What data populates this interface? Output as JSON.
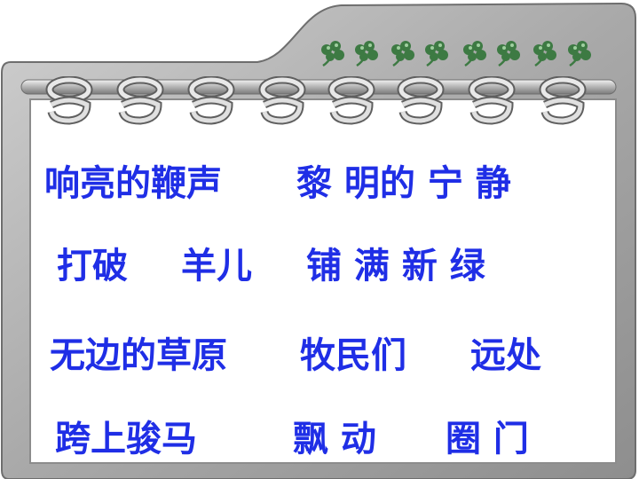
{
  "lines": [
    [
      "响亮的鞭声",
      "黎 明的 宁 静"
    ],
    [
      "打破",
      "羊儿",
      "铺 满 新 绿"
    ],
    [
      "无边的草原",
      "牧民们",
      "远处"
    ],
    [
      "跨上骏马",
      "飘 动",
      "圈  门"
    ]
  ],
  "colors": {
    "frame": "#a7a7a7",
    "text": "#1f2ee6",
    "ornament": "#3d7a43"
  },
  "icons": {
    "ornament": "clover-icon",
    "binding": "binder-ring-icon"
  }
}
